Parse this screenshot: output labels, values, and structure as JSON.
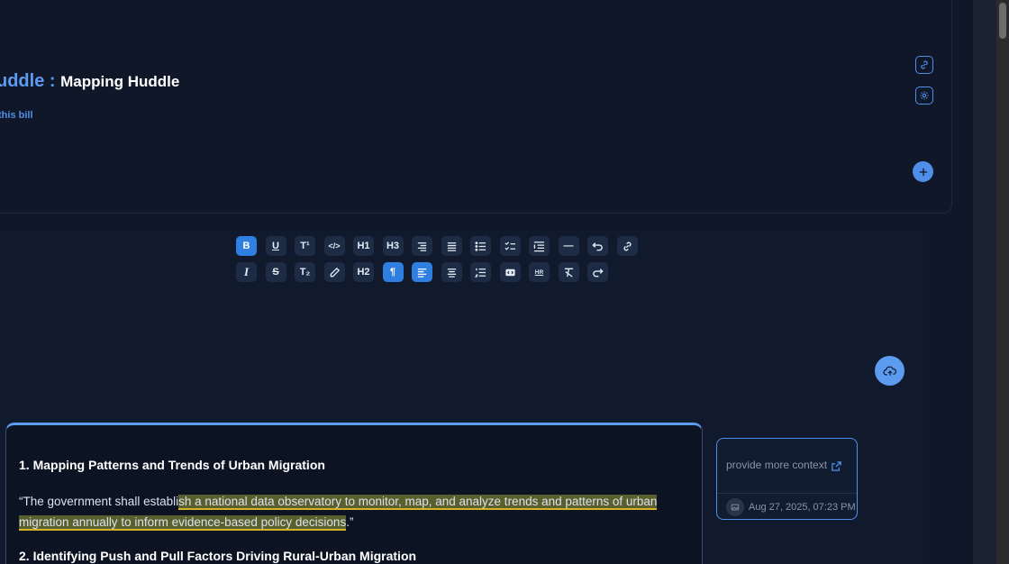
{
  "header": {
    "title_prefix": "uddle : ",
    "title": "Mapping Huddle",
    "subtitle": "this bill",
    "icons": [
      "link-icon",
      "gear-icon",
      "plus-icon"
    ]
  },
  "toolbar": {
    "row1": [
      {
        "label": "B",
        "icon": "bold-icon",
        "active": true
      },
      {
        "label": "U",
        "icon": "underline-icon",
        "active": false
      },
      {
        "label": "T¹",
        "icon": "superscript-icon",
        "active": false
      },
      {
        "label": "</>",
        "icon": "code-icon",
        "active": false
      },
      {
        "label": "H1",
        "icon": "heading1-icon",
        "active": false
      },
      {
        "label": "H3",
        "icon": "heading3-icon",
        "active": false
      },
      {
        "label": "",
        "icon": "align-right-icon",
        "active": false
      },
      {
        "label": "",
        "icon": "align-justify-icon",
        "active": false
      },
      {
        "label": "",
        "icon": "bullet-list-icon",
        "active": false
      },
      {
        "label": "",
        "icon": "checklist-icon",
        "active": false
      },
      {
        "label": "",
        "icon": "indent-icon",
        "active": false
      },
      {
        "label": "—",
        "icon": "horizontal-rule-icon",
        "active": false
      },
      {
        "label": "",
        "icon": "undo-icon",
        "active": false
      },
      {
        "label": "",
        "icon": "link-icon",
        "active": false
      }
    ],
    "row2": [
      {
        "label": "I",
        "icon": "italic-icon",
        "active": false
      },
      {
        "label": "S",
        "icon": "strikethrough-icon",
        "active": false
      },
      {
        "label": "T₂",
        "icon": "subscript-icon",
        "active": false
      },
      {
        "label": "",
        "icon": "highlight-pen-icon",
        "active": false
      },
      {
        "label": "H2",
        "icon": "heading2-icon",
        "active": false
      },
      {
        "label": "¶",
        "icon": "paragraph-icon",
        "active": true
      },
      {
        "label": "",
        "icon": "align-left-icon",
        "active": true
      },
      {
        "label": "",
        "icon": "align-center-icon",
        "active": false
      },
      {
        "label": "",
        "icon": "numbered-list-icon",
        "active": false
      },
      {
        "label": "",
        "icon": "code-block-icon",
        "active": false
      },
      {
        "label": "HR",
        "icon": "hr-icon",
        "active": false
      },
      {
        "label": "",
        "icon": "clear-format-icon",
        "active": false
      },
      {
        "label": "",
        "icon": "redo-icon",
        "active": false
      }
    ]
  },
  "document": {
    "heading1": "1. Mapping Patterns and Trends of Urban Migration",
    "para_before": " “The government shall establi",
    "para_highlight": "sh a national data observatory to monitor, map, and analyze trends and patterns of urban migration annually to inform evidence-based policy decisions",
    "para_after": ".”",
    "heading2": "2. Identifying Push and Pull Factors Driving Rural-Urban Migration"
  },
  "comment": {
    "text": "provide more context",
    "date": "Aug 27, 2025, 07:23 PM"
  },
  "colors": {
    "accent": "#4f8fea",
    "highlight": "#5a5f2e",
    "highlight_underline": "#d6b229",
    "background": "#0f1729"
  }
}
